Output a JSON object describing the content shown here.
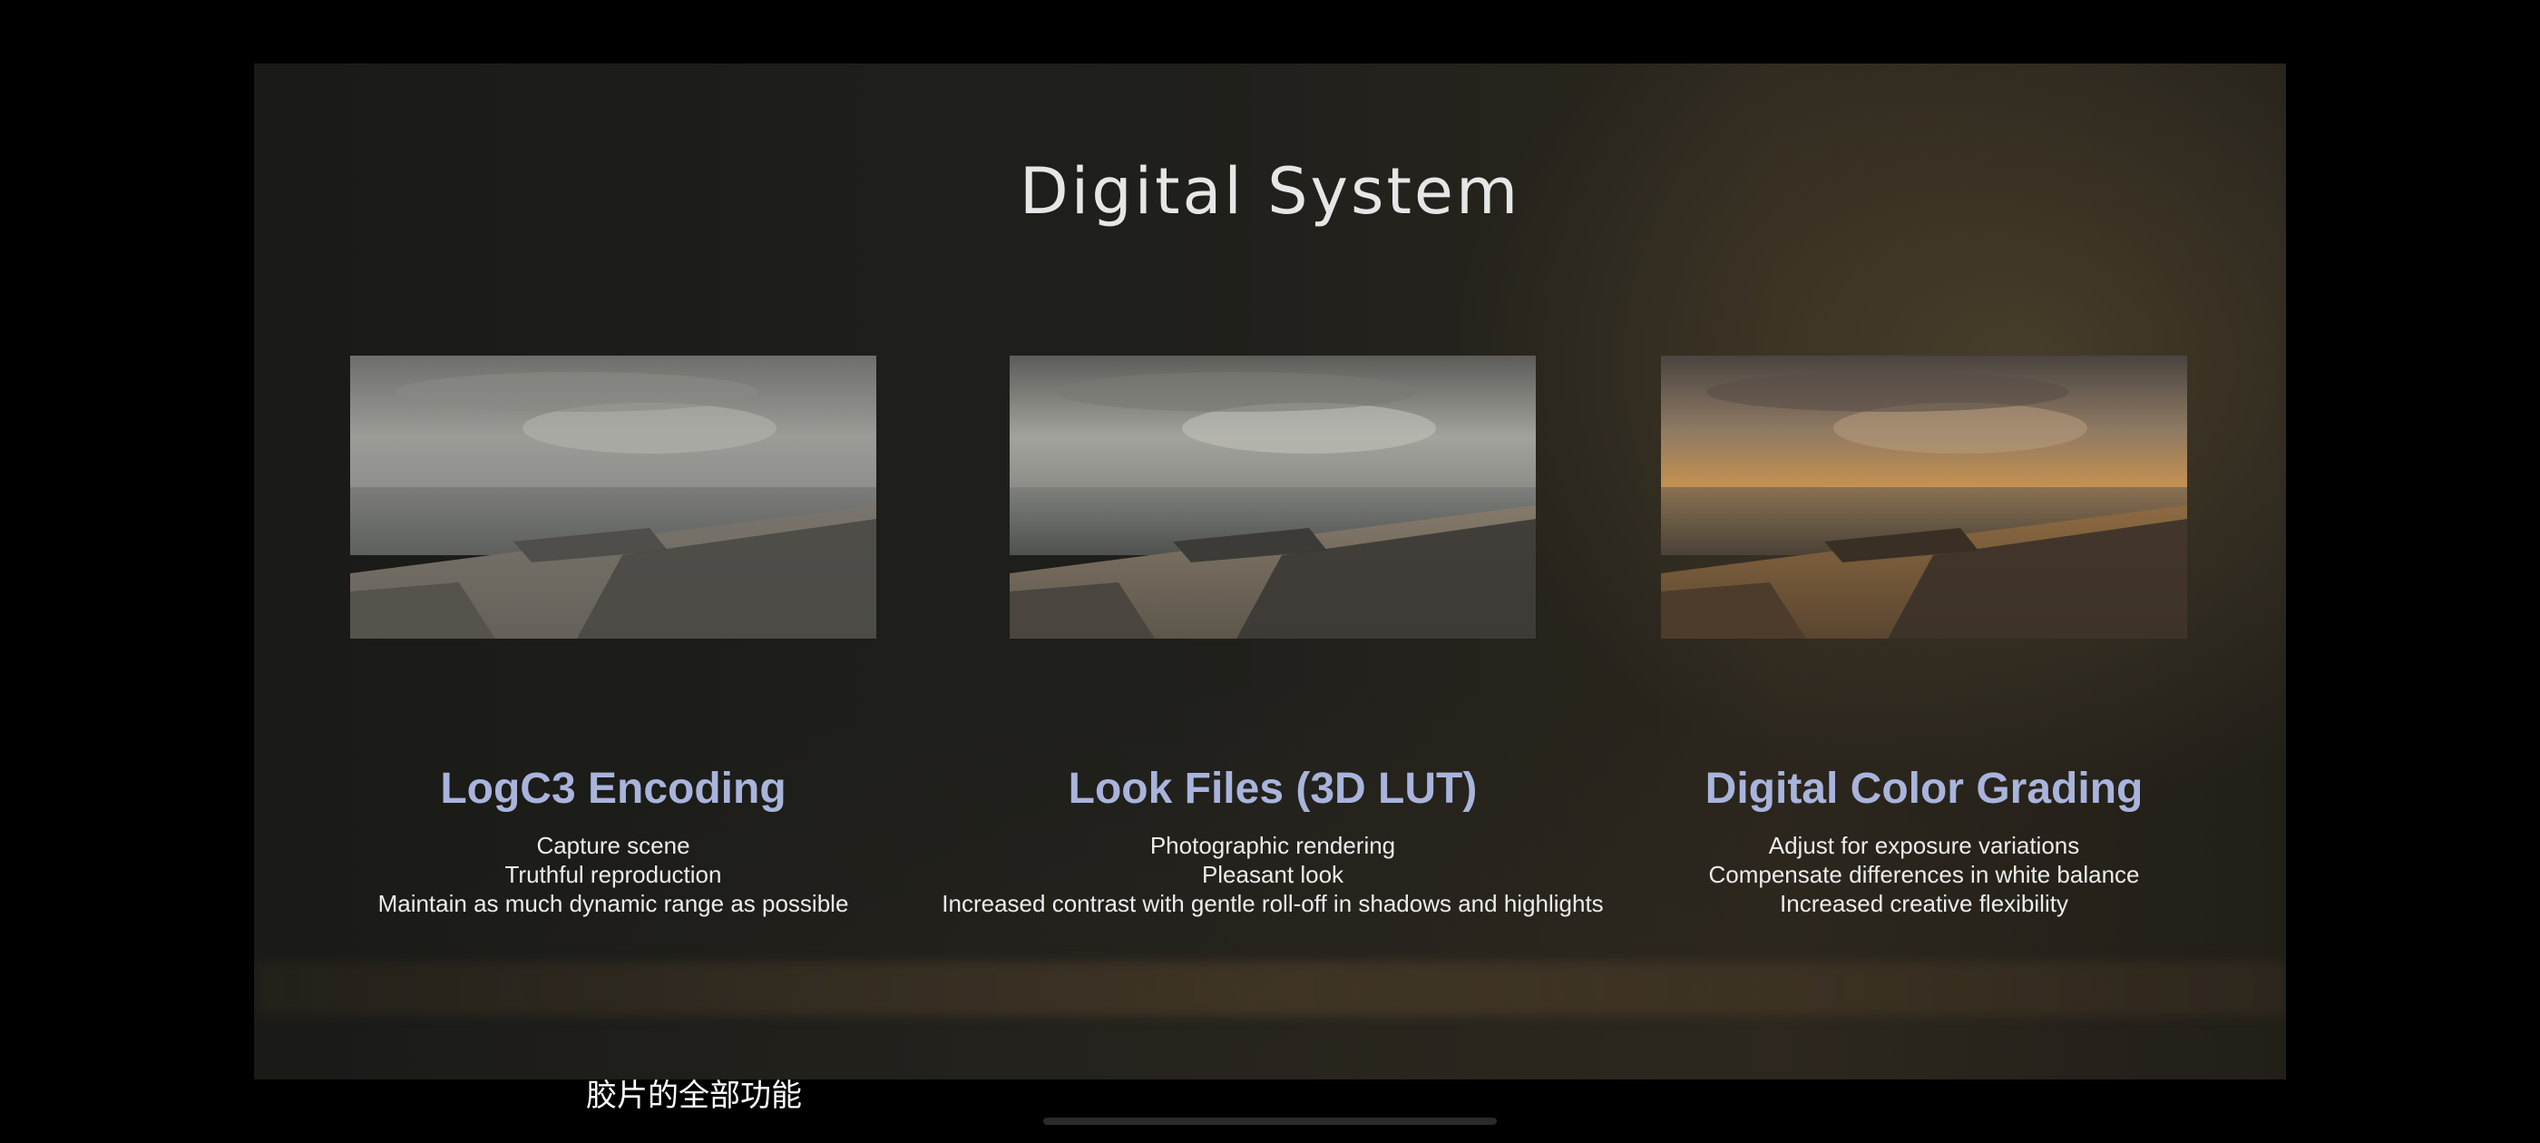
{
  "slide": {
    "title": "Digital System",
    "panels": [
      {
        "heading": "LogC3 Encoding",
        "lines": [
          "Capture scene",
          "Truthful reproduction",
          "Maintain as much dynamic range as possible"
        ],
        "tone": "log"
      },
      {
        "heading": "Look Files (3D LUT)",
        "lines": [
          "Photographic rendering",
          "Pleasant look",
          "Increased contrast with gentle roll-off in shadows and highlights"
        ],
        "tone": "lut"
      },
      {
        "heading": "Digital Color Grading",
        "lines": [
          "Adjust for exposure variations",
          "Compensate differences in white balance",
          "Increased creative flexibility"
        ],
        "tone": "graded"
      }
    ]
  },
  "subtitle": "胶片的全部功能",
  "colors": {
    "heading": "#a9b4dc",
    "title": "#e6e6e6",
    "body_text": "#ececec"
  }
}
